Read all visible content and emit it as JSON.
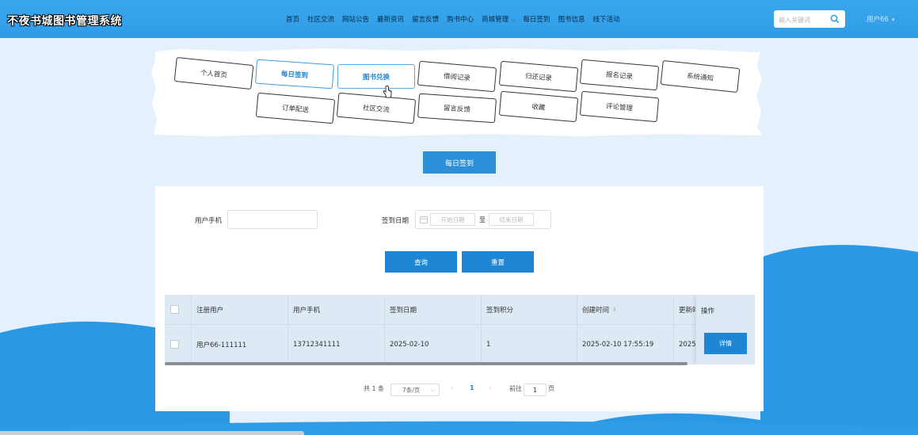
{
  "header": {
    "brand": "不夜书城图书管理系统",
    "nav": [
      "首页",
      "社区交流",
      "网站公告",
      "最新资讯",
      "留言反馈",
      "购书中心",
      "商城管理",
      "每日签到",
      "图书信息",
      "线下活动"
    ],
    "search_placeholder": "输入关键词",
    "user": "用户66"
  },
  "menu": {
    "row1": [
      "个人首页",
      "每日签到",
      "图书兑换",
      "借阅记录",
      "归还记录",
      "报名记录",
      "系统通知"
    ],
    "row2": [
      "订单配送",
      "社区交流",
      "留言反馈",
      "收藏",
      "评论管理"
    ]
  },
  "section_title": "每日签到",
  "filters": {
    "phone_label": "用户手机",
    "date_label": "签到日期",
    "start_placeholder": "开始日期",
    "end_placeholder": "结束日期",
    "range_sep": "至"
  },
  "buttons": {
    "query": "查询",
    "reset": "重置"
  },
  "table": {
    "headers": [
      "注册用户",
      "用户手机",
      "签到日期",
      "签到积分",
      "创建时间",
      "更新时",
      "操作"
    ],
    "rows": [
      {
        "user": "用户66-111111",
        "phone": "13712341111",
        "date": "2025-02-10",
        "points": "1",
        "created": "2025-02-10 17:55:19",
        "updated": "2025-",
        "action": "详情"
      }
    ]
  },
  "pager": {
    "total": "共 1 条",
    "page_size": "7条/页",
    "current": "1",
    "goto": "前往",
    "goto_value": "1",
    "page_unit": "页"
  },
  "colors": {
    "header": "#2f9ce7",
    "primary": "#1f86d6",
    "background": "#e4f0fb"
  }
}
